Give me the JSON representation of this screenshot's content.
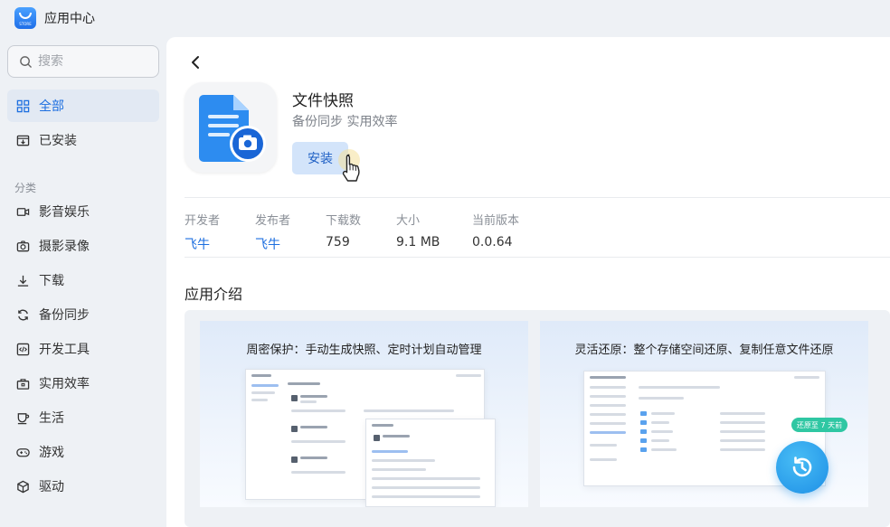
{
  "window": {
    "title": "应用中心",
    "logo_text": "STORE"
  },
  "sidebar": {
    "search_placeholder": "搜索",
    "items": [
      {
        "label": "全部",
        "icon": "grid-icon",
        "active": true
      },
      {
        "label": "已安装",
        "icon": "installed-icon",
        "active": false
      }
    ],
    "category_label": "分类",
    "categories": [
      {
        "label": "影音娱乐",
        "icon": "video-camera-icon"
      },
      {
        "label": "摄影录像",
        "icon": "camera-icon"
      },
      {
        "label": "下载",
        "icon": "download-icon"
      },
      {
        "label": "备份同步",
        "icon": "sync-icon"
      },
      {
        "label": "开发工具",
        "icon": "code-icon"
      },
      {
        "label": "实用效率",
        "icon": "toolbox-icon"
      },
      {
        "label": "生活",
        "icon": "cup-icon"
      },
      {
        "label": "游戏",
        "icon": "gamepad-icon"
      },
      {
        "label": "驱动",
        "icon": "cube-icon"
      }
    ]
  },
  "app": {
    "name": "文件快照",
    "categories": "备份同步 实用效率",
    "install_label": "安装",
    "meta": [
      {
        "key": "开发者",
        "value": "飞牛",
        "link": true
      },
      {
        "key": "发布者",
        "value": "飞牛",
        "link": true
      },
      {
        "key": "下载数",
        "value": "759",
        "link": false
      },
      {
        "key": "大小",
        "value": "9.1 MB",
        "link": false
      },
      {
        "key": "当前版本",
        "value": "0.0.64",
        "link": false
      }
    ]
  },
  "intro": {
    "title": "应用介绍",
    "screenshots": [
      {
        "caption": "周密保护：手动生成快照、定时计划自动管理"
      },
      {
        "caption": "灵活还原：整个存储空间还原、复制任意文件还原",
        "badge": "还原至 7 天前"
      }
    ]
  },
  "colors": {
    "accent": "#1d6fe0",
    "install_bg": "#d3e4fa",
    "badge": "#2fc7a3"
  }
}
